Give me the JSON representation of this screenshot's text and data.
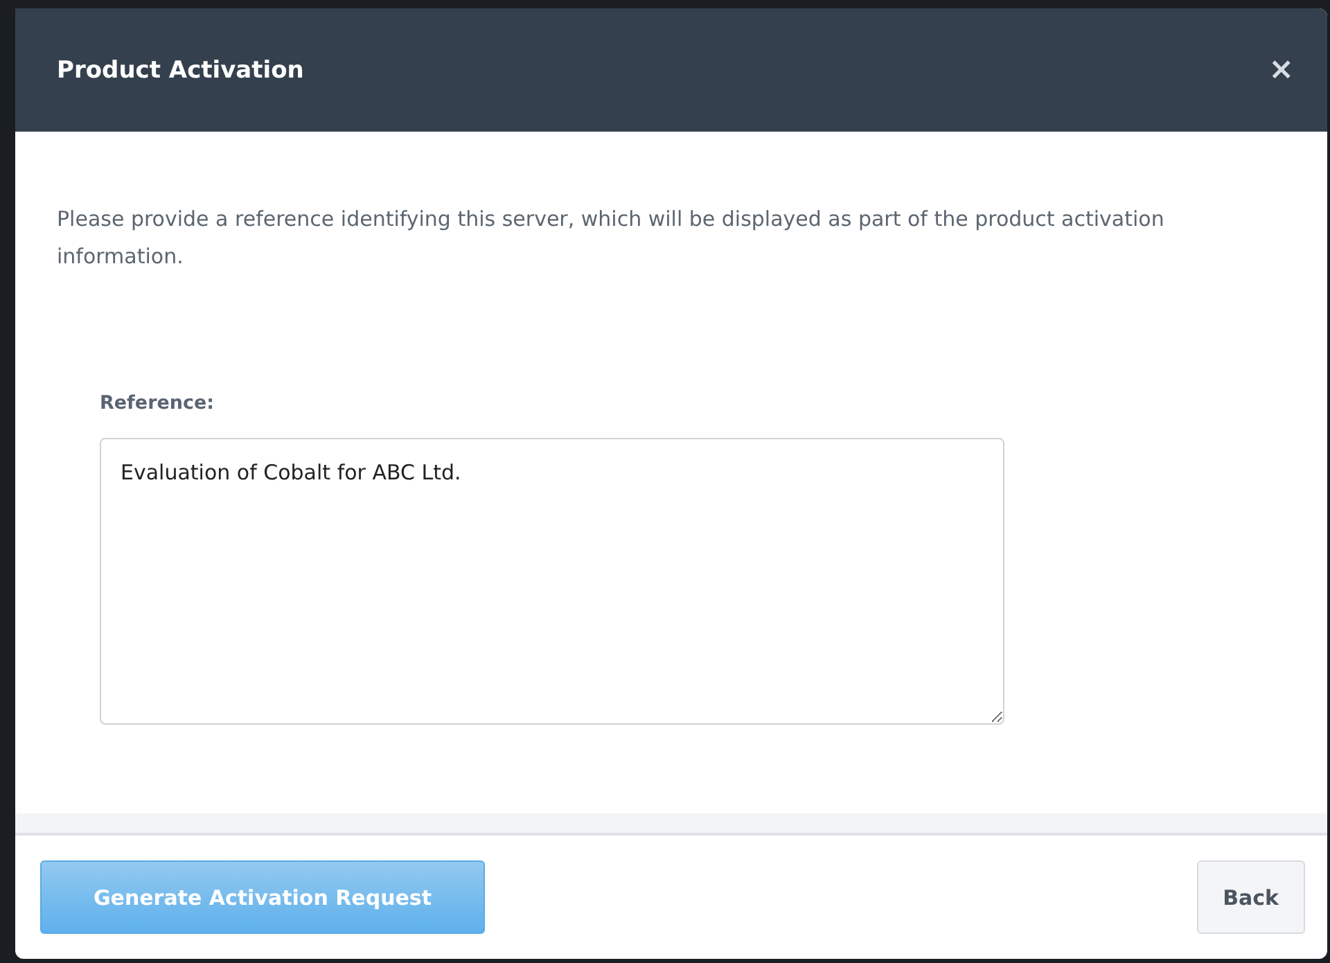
{
  "dialog": {
    "title": "Product Activation",
    "close": "×"
  },
  "description": "Please provide a reference identifying this server, which will be displayed as part of the product activation information.",
  "reference": {
    "label": "Reference:",
    "value": "Evaluation of Cobalt for ABC Ltd."
  },
  "buttons": [
    {
      "label": "Generate Activation Request",
      "kind": "primary"
    },
    {
      "label": "Back",
      "kind": "secondary"
    }
  ]
}
